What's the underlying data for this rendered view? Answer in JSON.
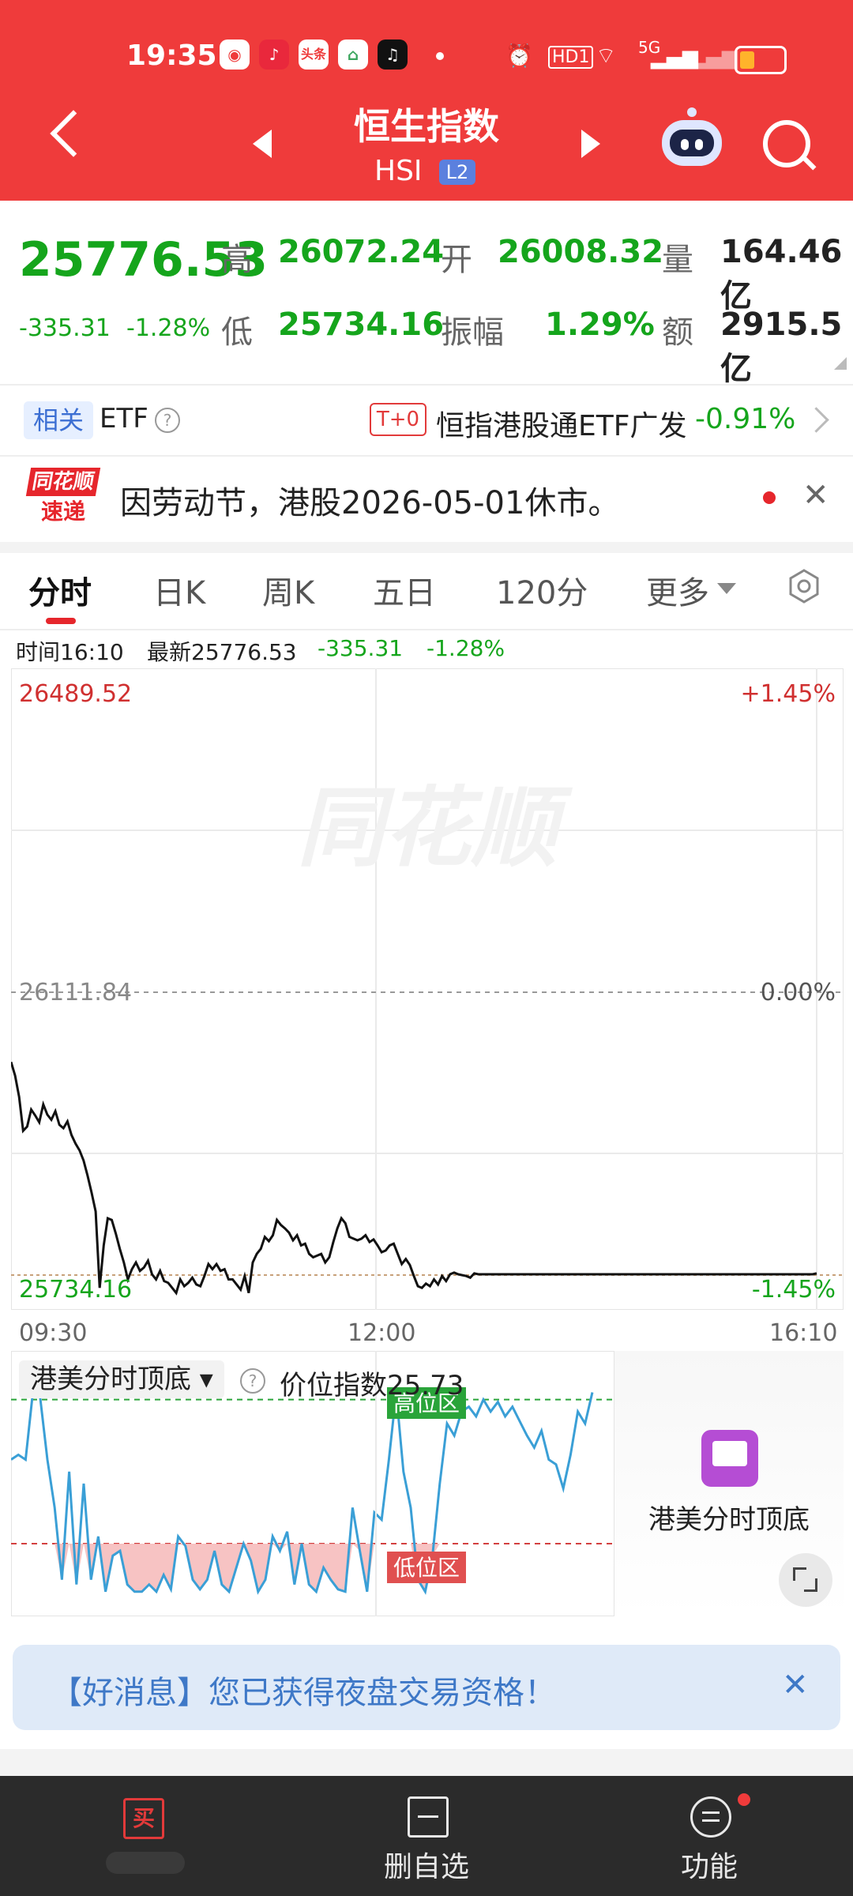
{
  "status_bar": {
    "time": "19:35",
    "app_icons": [
      "shop-icon",
      "music-icon",
      "头条",
      "home-icon",
      "tiktok-icon"
    ],
    "hd_label": "HD1",
    "network_label": "5G",
    "battery_level": 0.35
  },
  "header": {
    "title": "恒生指数",
    "code": "HSI",
    "level_badge": "L2"
  },
  "quote": {
    "price": "25776.53",
    "change": "-335.31",
    "change_pct": "-1.28%",
    "high_label": "高",
    "high": "26072.24",
    "low_label": "低",
    "low": "25734.16",
    "open_label": "开",
    "open": "26008.32",
    "amp_label": "振幅",
    "amp": "1.29%",
    "vol_label": "量",
    "volume": "164.46亿",
    "amt_label": "额",
    "amount": "2915.5亿"
  },
  "etf": {
    "tag": "相关",
    "label": "ETF",
    "t0": "T+0",
    "name": "恒指港股通ETF广发",
    "change": "-0.91%"
  },
  "news": {
    "logo_top": "同花顺",
    "logo_bottom": "速递",
    "text": "因劳动节，港股2026-05-01休市。"
  },
  "tabs": [
    "分时",
    "日K",
    "周K",
    "五日",
    "120分",
    "更多"
  ],
  "info_line": {
    "time": "时间16:10",
    "latest": "最新25776.53",
    "change": "-335.31",
    "pct": "-1.28%"
  },
  "chart_data": [
    {
      "type": "line",
      "title": "",
      "watermark": "同花顺",
      "x_tick_labels": [
        "09:30",
        "12:00",
        "16:10"
      ],
      "y_left_labels": {
        "max": "26489.52",
        "mid": "26111.84",
        "min": "25734.16"
      },
      "y_right_labels": {
        "max": "+1.45%",
        "mid": "0.00%",
        "min": "-1.45%"
      },
      "ylim": [
        25734.16,
        26489.52
      ],
      "base_value": 26111.84,
      "series": [
        {
          "x": [
            0,
            0.5,
            1,
            1.5,
            2,
            2.5,
            3,
            3.5,
            4,
            4.5,
            5,
            5.5,
            6,
            6.5,
            7,
            7.5,
            8,
            8.5,
            9,
            9.5,
            10,
            10.5,
            11,
            11.5,
            12,
            12.5,
            13,
            13.5,
            14,
            14.5,
            15,
            15.5,
            16,
            16.5,
            17,
            17.5,
            18,
            18.5,
            19,
            19.5,
            20,
            20.5,
            21,
            21.5,
            22,
            22.5,
            23,
            23.5,
            24,
            24.5,
            25,
            25.5,
            26,
            26.5,
            27,
            27.5,
            28,
            28.5,
            29,
            29.5,
            30,
            30.5,
            31,
            31.5,
            32,
            32.5,
            33,
            33.5,
            34,
            34.5,
            35,
            35.5,
            36,
            36.5,
            37,
            37.5,
            38,
            38.5,
            39,
            39.5,
            40,
            40.5,
            41,
            41.5,
            42,
            42.5,
            43,
            43.5,
            44,
            44.5,
            45,
            45.5,
            46,
            46.5,
            47,
            47.5,
            48,
            48.5,
            49,
            49.5,
            50,
            50.5,
            51,
            51.5,
            52,
            52.5,
            53,
            53.5,
            54,
            54.5,
            55,
            55.5,
            56,
            56.5,
            57,
            57.5,
            58,
            58.5,
            59,
            59.5,
            60,
            60.5,
            61,
            61.5,
            62,
            62.5,
            63,
            63.5,
            64,
            64.5,
            65,
            65.5,
            66,
            66.5,
            67,
            67.5,
            68,
            68.5,
            69,
            69.5,
            70,
            70.5,
            71,
            71.5,
            72,
            72.5,
            73,
            73.5,
            74,
            74.5,
            75,
            75.5,
            76,
            76.5,
            77,
            77.5,
            78,
            78.5,
            79,
            79.5,
            80,
            80.5,
            81,
            81.5,
            82,
            82.5,
            83,
            83.5,
            84,
            84.5,
            85,
            85.5,
            86,
            86.5,
            87,
            87.5,
            88,
            88.5,
            89,
            89.5,
            90,
            90.5,
            91,
            91.5,
            92,
            92.5,
            93,
            93.5,
            94,
            94.5,
            95,
            95.5,
            96,
            96.5,
            97,
            97.5,
            98,
            98.5,
            99,
            99.5,
            100
          ],
          "values": [
            26026,
            26010,
            25985,
            25945,
            25950,
            25970,
            25963,
            25955,
            25976,
            25964,
            25958,
            25968,
            25952,
            25948,
            25956,
            25940,
            25930,
            25922,
            25910,
            25892,
            25872,
            25850,
            25760,
            25810,
            25842,
            25840,
            25824,
            25806,
            25790,
            25770,
            25782,
            25790,
            25780,
            25784,
            25792,
            25776,
            25770,
            25780,
            25768,
            25766,
            25760,
            25754,
            25770,
            25762,
            25766,
            25772,
            25764,
            25762,
            25774,
            25788,
            25782,
            25788,
            25780,
            25782,
            25770,
            25770,
            25764,
            25758,
            25774,
            25754,
            25790,
            25800,
            25806,
            25820,
            25815,
            25822,
            25840,
            25834,
            25830,
            25825,
            25816,
            25822,
            25810,
            25812,
            25800,
            25796,
            25798,
            25800,
            25790,
            25796,
            25814,
            25830,
            25842,
            25836,
            25820,
            25818,
            25816,
            25818,
            25822,
            25814,
            25817,
            25810,
            25802,
            25804,
            25810,
            25812,
            25800,
            25788,
            25794,
            25787,
            25774,
            25762,
            25760,
            25765,
            25762,
            25770,
            25764,
            25774,
            25768,
            25776,
            25778,
            25776,
            25775,
            25774,
            25772,
            25777,
            25776,
            25776,
            25776,
            25776,
            25776,
            25776,
            25776,
            25776,
            25776,
            25776,
            25776,
            25776,
            25776,
            25776,
            25776,
            25776,
            25776,
            25776,
            25776,
            25776,
            25776,
            25776,
            25776,
            25776,
            25776,
            25776,
            25776,
            25776,
            25776,
            25776,
            25776,
            25776,
            25776,
            25776,
            25776,
            25776,
            25776,
            25776,
            25776,
            25776,
            25776,
            25776,
            25776,
            25776,
            25776,
            25776,
            25776,
            25776,
            25776,
            25776,
            25776,
            25776,
            25776,
            25776,
            25776,
            25776,
            25776,
            25776,
            25776,
            25776,
            25776,
            25776,
            25776,
            25776,
            25776,
            25776,
            25776,
            25776,
            25776,
            25776,
            25776,
            25776,
            25776,
            25776,
            25776,
            25776,
            25776,
            25776,
            25776,
            25776,
            25776,
            25776,
            25776,
            25776,
            25777
          ]
        }
      ]
    },
    {
      "type": "line",
      "title": "港美分时顶底",
      "value_label": "价位指数25.73",
      "zone_high_label": "高位区",
      "zone_low_label": "低位区",
      "ylim": [
        0,
        100
      ],
      "high_zone": 85,
      "low_zone": 25,
      "series": [
        {
          "values": [
            60,
            62,
            60,
            88,
            86,
            60,
            40,
            10,
            55,
            8,
            50,
            10,
            28,
            5,
            20,
            22,
            8,
            5,
            5,
            8,
            5,
            12,
            6,
            28,
            24,
            10,
            6,
            10,
            22,
            8,
            5,
            15,
            25,
            18,
            5,
            10,
            28,
            22,
            30,
            8,
            25,
            8,
            5,
            15,
            10,
            6,
            5,
            40,
            22,
            5,
            38,
            35,
            60,
            88,
            55,
            40,
            10,
            5,
            20,
            50,
            75,
            70,
            80,
            82,
            78,
            85,
            80,
            84,
            78,
            82,
            76,
            70,
            65,
            72,
            60,
            58,
            48,
            62,
            80,
            75,
            88
          ]
        }
      ]
    }
  ],
  "side_panel": {
    "label": "港美分时顶底"
  },
  "banner": {
    "text": "【好消息】您已获得夜盘交易资格！"
  },
  "bottom_nav": {
    "buy": "买",
    "remove": "删自选",
    "func": "功能"
  },
  "colors": {
    "brand_red": "#ef3b3b",
    "down_green": "#15a51c",
    "line_black": "#111111",
    "indicator_blue": "#3a9fd6"
  }
}
